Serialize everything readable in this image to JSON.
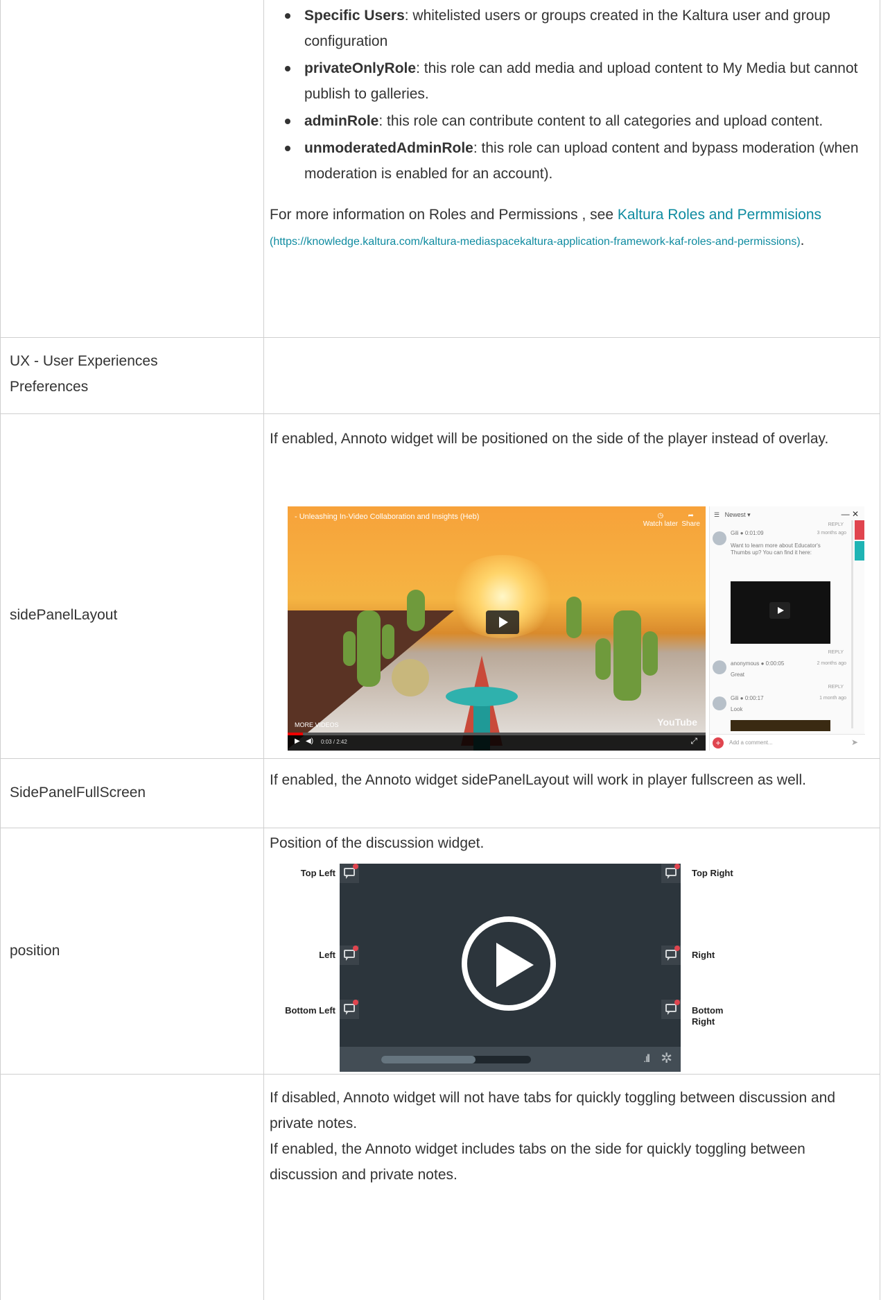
{
  "roles_list": [
    {
      "term": "Specific Users",
      "desc": ": whitelisted users or groups created in the Kaltura user and group configuration"
    },
    {
      "term": "privateOnlyRole",
      "desc": ": this role can add media and upload content to My Media but cannot publish to galleries."
    },
    {
      "term": "adminRole",
      "desc": ": this role can contribute content to all categories and upload content."
    },
    {
      "term": "unmoderatedAdminRole",
      "desc": ": this role can upload content and bypass moderation (when moderation is enabled for an account)."
    }
  ],
  "more_info": {
    "prefix": "For more information on Roles and Permissions , see",
    "link_text": "Kaltura Roles and Permmisions",
    "url_text": "(https://knowledge.kaltura.com/kaltura-mediaspacekaltura-application-framework-kaf-roles-and-permissions)",
    "suffix": "."
  },
  "rows": {
    "ux": {
      "label": "UX  -  User Experiences Preferences"
    },
    "side_panel_layout": {
      "label": "sidePanelLayout",
      "desc": "If enabled, Annoto widget will be positioned on the side of the player instead of overlay."
    },
    "side_panel_fullscreen": {
      "label": "SidePanelFullScreen",
      "desc": "If enabled, the Annoto widget sidePanelLayout will work in player fullscreen as well."
    },
    "position": {
      "label": "position",
      "desc": "Position of the discussion widget."
    },
    "tabs": {
      "label": "",
      "desc_disabled": "If disabled, Annoto widget will not have tabs for quickly toggling between discussion and private notes.",
      "desc_enabled": "If enabled, the Annoto widget includes tabs on the side for quickly toggling between discussion and private notes."
    }
  },
  "side_panel_image": {
    "video_title": "- Unleashing In-Video Collaboration and Insights (Heb)",
    "watch_later": "Watch later",
    "share": "Share",
    "more_videos": "MORE VIDEOS",
    "time": "0:03 / 2:42",
    "yt_logo": "YouTube",
    "panel_sort": "Newest ▾",
    "reply": "REPLY",
    "comments": [
      {
        "author": "Gili  ● 0:01:09",
        "age": "3 months ago",
        "text": "Want to learn more about Educator's Thumbs up? You can find it here:"
      },
      {
        "author": "anonymous  ● 0:00:05",
        "age": "2 months ago",
        "text": "Great"
      },
      {
        "author": "Gili  ● 0:00:17",
        "age": "1 month ago",
        "text": "Look"
      }
    ],
    "add_comment": "Add a comment..."
  },
  "position_image": {
    "labels": {
      "top_left": "Top Left",
      "top_right": "Top Right",
      "left": "Left",
      "right": "Right",
      "bottom_left": "Bottom Left",
      "bottom_right": "Bottom Right"
    },
    "progress": 0.63
  }
}
